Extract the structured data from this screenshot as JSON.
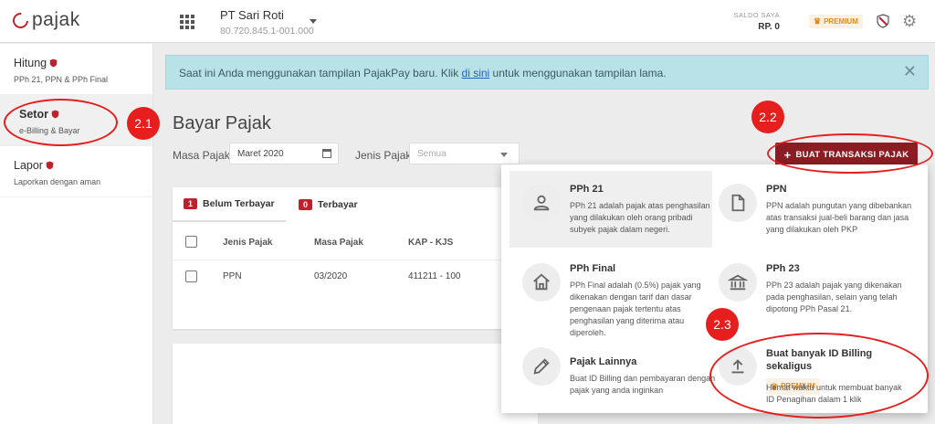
{
  "header": {
    "logo_text": "pajak",
    "company_name": "PT Sari Roti",
    "company_npwp": "80.720.845.1-001.000",
    "saldo_label": "SALDO SAYA",
    "saldo_value": "RP. 0",
    "premium_label": "PREMIUM"
  },
  "sidebar": {
    "items": [
      {
        "title": "Hitung",
        "subtitle": "PPh 21, PPN & PPh Final",
        "active": false
      },
      {
        "title": "Setor",
        "subtitle": "e-Billing & Bayar",
        "active": true
      },
      {
        "title": "Lapor",
        "subtitle": "Laporkan dengan aman",
        "active": false
      }
    ]
  },
  "banner": {
    "text_before": "Saat ini Anda menggunakan tampilan PajakPay baru. Klik ",
    "link_text": "di sini",
    "text_after": " untuk menggunakan tampilan lama.",
    "close_glyph": "✕"
  },
  "main": {
    "title": "Bayar Pajak",
    "masa_label": "Masa Pajak",
    "masa_value": "Maret 2020",
    "jenis_label": "Jenis Pajak",
    "jenis_placeholder": "Semua",
    "cta_label": "BUAT TRANSAKSI PAJAK",
    "cta_glyph": "+"
  },
  "table": {
    "tabs": [
      {
        "count": "1",
        "label": "Belum Terbayar"
      },
      {
        "count": "0",
        "label": "Terbayar"
      }
    ],
    "columns": [
      "Jenis Pajak",
      "Masa Pajak",
      "KAP - KJS"
    ],
    "rows": [
      {
        "jenis": "PPN",
        "masa": "03/2020",
        "kap": "411211 - 100"
      }
    ]
  },
  "menu": {
    "items": [
      {
        "title": "PPh 21",
        "desc": "PPh 21 adalah pajak atas penghasilan yang dilakukan oleh orang pribadi subyek pajak dalam negeri.",
        "icon": "person-icon"
      },
      {
        "title": "PPN",
        "desc": "PPN adalah pungutan yang dibebankan atas transaksi jual-beli barang dan jasa yang dilakukan oleh PKP",
        "icon": "document-icon"
      },
      {
        "title": "PPh Final",
        "desc": "PPh Final adalah (0.5%) pajak yang dikenakan dengan tarif dan dasar pengenaan pajak tertentu atas penghasilan yang diterima atau diperoleh.",
        "icon": "home-icon"
      },
      {
        "title": "PPh 23",
        "desc": "PPh 23 adalah pajak yang dikenakan pada penghasilan, selain yang telah dipotong PPh Pasal 21.",
        "icon": "bank-icon"
      },
      {
        "title": "Pajak Lainnya",
        "desc": "Buat ID Billing dan pembayaran dengan pajak yang anda inginkan",
        "icon": "pencil-icon"
      },
      {
        "title": "Buat banyak ID Billing sekaligus",
        "desc": "Hemat waktu untuk membuat banyak ID Penagihan dalam 1 klik",
        "icon": "upload-icon",
        "badge": "PREMIUM"
      }
    ]
  },
  "annotations": {
    "m21": "2.1",
    "m22": "2.2",
    "m23": "2.3"
  },
  "colors": {
    "brand_red": "#8b1c23",
    "accent_red": "#c21f2b",
    "annotation_red": "#e61e1e",
    "banner_bg": "#b8e2e8",
    "premium_orange": "#e68a1d"
  }
}
